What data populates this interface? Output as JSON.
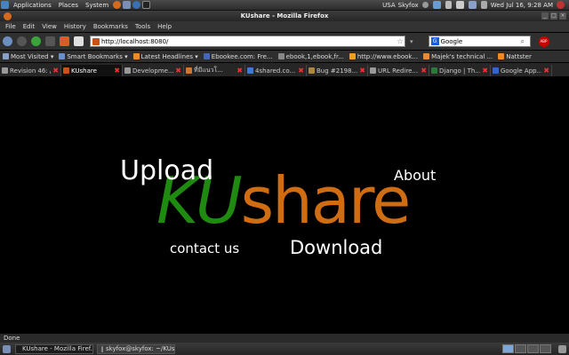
{
  "top_panel": {
    "menus": [
      "Applications",
      "Places",
      "System"
    ],
    "keyboard_layout": "USA",
    "user": "Skyfox",
    "clock": "Wed Jul 16,  9:28 AM"
  },
  "window": {
    "title": "KUshare - Mozilla Firefox"
  },
  "menubar": {
    "items": [
      "File",
      "Edit",
      "View",
      "History",
      "Bookmarks",
      "Tools",
      "Help"
    ]
  },
  "navbar": {
    "url": "http://localhost:8080/",
    "search_engine": "Google",
    "search_placeholder": "Google",
    "adblock_label": "ABP"
  },
  "bookmarks": [
    {
      "label": "Most Visited ▾",
      "color": "#8aa0c8"
    },
    {
      "label": "Smart Bookmarks ▾",
      "color": "#6a8fd0"
    },
    {
      "label": "Latest Headlines ▾",
      "color": "#f08a24"
    },
    {
      "label": "Ebookee.com: Fre...",
      "color": "#4466bb"
    },
    {
      "label": "ebook,1,ebook,fr...",
      "color": "#888888"
    },
    {
      "label": "http://www.ebook...",
      "color": "#f0a020"
    },
    {
      "label": "Majek's technical ...",
      "color": "#f08a24"
    },
    {
      "label": "Nattster",
      "color": "#f08a24"
    }
  ],
  "tabs": [
    {
      "label": "Revision 46: /",
      "active": false,
      "color": "#999999"
    },
    {
      "label": "KUshare",
      "active": true,
      "color": "#c7521a"
    },
    {
      "label": "Developme...",
      "active": false,
      "color": "#999999"
    },
    {
      "label": "ที่มีแนวโ...",
      "active": false,
      "color": "#cc7733"
    },
    {
      "label": "4shared.co...",
      "active": false,
      "color": "#3a7bd5"
    },
    {
      "label": "Bug #2198...",
      "active": false,
      "color": "#aa8844"
    },
    {
      "label": "URL Redire...",
      "active": false,
      "color": "#999999"
    },
    {
      "label": "Django | Th...",
      "active": false,
      "color": "#2b7a3b"
    },
    {
      "label": "Google App...",
      "active": false,
      "color": "#3366cc"
    }
  ],
  "page": {
    "logo_ku": "KU",
    "logo_share": "share",
    "upload": "Upload",
    "about": "About",
    "contact": "contact us",
    "download": "Download",
    "colors": {
      "ku_green": "#1f8a10",
      "share_orange": "#d06d12"
    }
  },
  "statusbar": {
    "text": "Done"
  },
  "taskbar": {
    "items": [
      {
        "label": "KUshare - Mozilla Firef...",
        "active": true
      },
      {
        "label": "skyfox@skyfox: ~/KUs...",
        "active": false
      }
    ]
  }
}
